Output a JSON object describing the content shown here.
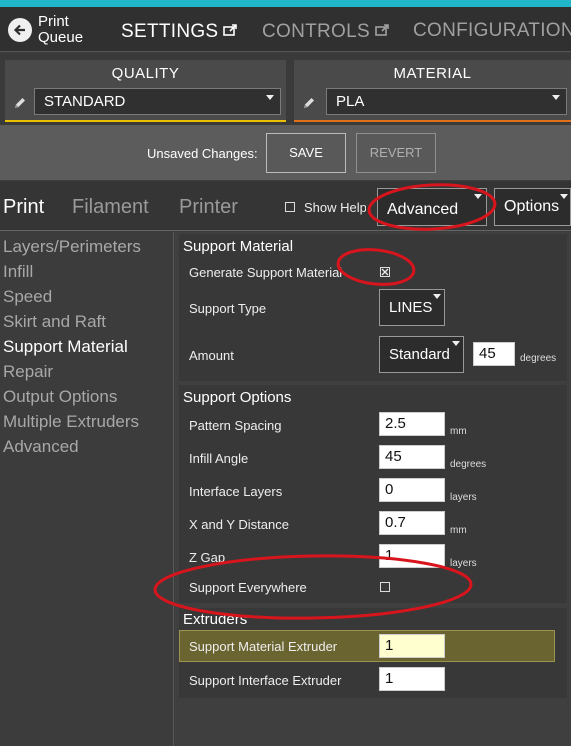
{
  "nav": {
    "back_label": "Print Queue",
    "tabs": [
      {
        "label": "SETTINGS",
        "active": true
      },
      {
        "label": "CONTROLS",
        "active": false
      },
      {
        "label": "CONFIGURATION",
        "active": false
      }
    ]
  },
  "presets": {
    "quality_title": "QUALITY",
    "quality_value": "STANDARD",
    "material_title": "MATERIAL",
    "material_value": "PLA"
  },
  "unsaved": {
    "label": "Unsaved Changes:",
    "save": "SAVE",
    "revert": "REVERT"
  },
  "subtabs": {
    "print": "Print",
    "filament": "Filament",
    "printer": "Printer",
    "show_help": "Show Help",
    "show_help_checked": false,
    "advanced": "Advanced",
    "options": "Options"
  },
  "sidebar": {
    "items": [
      {
        "label": "Layers/Perimeters",
        "active": false
      },
      {
        "label": "Infill",
        "active": false
      },
      {
        "label": "Speed",
        "active": false
      },
      {
        "label": "Skirt and Raft",
        "active": false
      },
      {
        "label": "Support Material",
        "active": true
      },
      {
        "label": "Repair",
        "active": false
      },
      {
        "label": "Output Options",
        "active": false
      },
      {
        "label": "Multiple Extruders",
        "active": false
      },
      {
        "label": "Advanced",
        "active": false
      }
    ]
  },
  "support_material": {
    "title": "Support Material",
    "generate_label": "Generate Support Material",
    "generate_checked": true,
    "type_label": "Support Type",
    "type_value": "LINES",
    "amount_label": "Amount",
    "amount_select": "Standard",
    "amount_value": "45",
    "amount_unit": "degrees"
  },
  "support_options": {
    "title": "Support Options",
    "pattern_spacing_label": "Pattern Spacing",
    "pattern_spacing_value": "2.5",
    "pattern_spacing_unit": "mm",
    "infill_angle_label": "Infill Angle",
    "infill_angle_value": "45",
    "infill_angle_unit": "degrees",
    "interface_layers_label": "Interface Layers",
    "interface_layers_value": "0",
    "interface_layers_unit": "layers",
    "xy_distance_label": "X and Y Distance",
    "xy_distance_value": "0.7",
    "xy_distance_unit": "mm",
    "z_gap_label": "Z Gap",
    "z_gap_value": "1",
    "z_gap_unit": "layers",
    "everywhere_label": "Support Everywhere",
    "everywhere_checked": false
  },
  "extruders": {
    "title": "Extruders",
    "material_extruder_label": "Support Material Extruder",
    "material_extruder_value": "1",
    "interface_extruder_label": "Support Interface Extruder",
    "interface_extruder_value": "1"
  },
  "colors": {
    "accent_strip": "#1fb6c9",
    "quality_underline": "#e8c000",
    "material_underline": "#e0701a",
    "annotation_red": "#d8141c",
    "highlight_row": "#6a6530"
  }
}
